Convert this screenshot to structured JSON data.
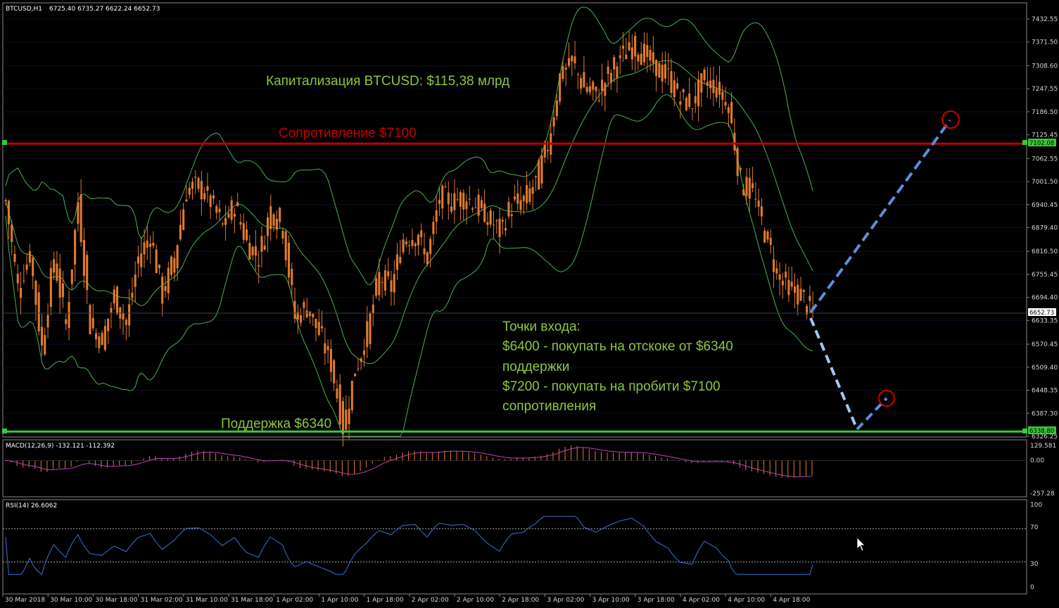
{
  "header": {
    "symbol": "BTCUSD,H1",
    "ohlc": "6725.40 6735.27 6622.24 6652.73"
  },
  "annotations": {
    "cap": "Капитализация BTCUSD: $115,38 млрд",
    "resistance": "Сопротивление $7100",
    "support": "Поддержка $6340",
    "entry_title": "Точки входа:",
    "entry_1a": "$6400 - покупать на отскоке от $6340",
    "entry_1b": "поддержки",
    "entry_2a": "$7200 - покупать на пробити $7100",
    "entry_2b": "сопротивления"
  },
  "colors": {
    "background": "#000000",
    "candle": "#e07b2c",
    "bands": "#4caf50",
    "resistance": "#c00000",
    "support": "#33cc33",
    "macd_hist": "#e07b2c",
    "macd_signal": "#c040c0",
    "rsi": "#3a6fd8",
    "forecast_up": "#5b8ede",
    "forecast_down": "#9ec9f0",
    "marker": "#cc0000"
  },
  "chart_data": {
    "type": "candlestick",
    "price_axis": {
      "ticks": [
        "7432.55",
        "7371.50",
        "7308.60",
        "7247.55",
        "7186.50",
        "7125.45",
        "7062.55",
        "7001.50",
        "6940.45",
        "6879.40",
        "6816.50",
        "6755.45",
        "6694.40",
        "6633.35",
        "6570.45",
        "6509.40",
        "6448.35",
        "6387.30",
        "6326.25"
      ],
      "range": [
        6326.25,
        7432.55
      ]
    },
    "time_axis": [
      "30 Mar 2018",
      "30 Mar 10:00",
      "30 Mar 18:00",
      "31 Mar 02:00",
      "31 Mar 10:00",
      "31 Mar 18:00",
      "1 Apr 02:00",
      "1 Apr 10:00",
      "1 Apr 18:00",
      "2 Apr 02:00",
      "2 Apr 10:00",
      "2 Apr 18:00",
      "3 Apr 02:00",
      "3 Apr 10:00",
      "3 Apr 18:00",
      "4 Apr 02:00",
      "4 Apr 10:00",
      "4 Apr 18:00"
    ],
    "resistance": {
      "label": "7102.08",
      "value": 7102.08
    },
    "support": {
      "label": "6338.80",
      "value": 6338.8
    },
    "current": {
      "label": "6652.73",
      "value": 6652.73
    },
    "close_path": [
      [
        0,
        6950
      ],
      [
        4,
        6720
      ],
      [
        8,
        6810
      ],
      [
        12,
        6560
      ],
      [
        16,
        6800
      ],
      [
        20,
        6620
      ],
      [
        24,
        6950
      ],
      [
        28,
        6620
      ],
      [
        32,
        6580
      ],
      [
        36,
        6700
      ],
      [
        40,
        6620
      ],
      [
        44,
        6800
      ],
      [
        48,
        6860
      ],
      [
        52,
        6700
      ],
      [
        56,
        6800
      ],
      [
        60,
        6980
      ],
      [
        64,
        6990
      ],
      [
        68,
        6950
      ],
      [
        72,
        6880
      ],
      [
        76,
        6940
      ],
      [
        80,
        6840
      ],
      [
        84,
        6800
      ],
      [
        88,
        6930
      ],
      [
        92,
        6880
      ],
      [
        96,
        6640
      ],
      [
        100,
        6670
      ],
      [
        104,
        6600
      ],
      [
        108,
        6520
      ],
      [
        112,
        6350
      ],
      [
        116,
        6500
      ],
      [
        120,
        6600
      ],
      [
        124,
        6750
      ],
      [
        128,
        6720
      ],
      [
        132,
        6850
      ],
      [
        136,
        6860
      ],
      [
        140,
        6800
      ],
      [
        144,
        6960
      ],
      [
        148,
        6950
      ],
      [
        152,
        6960
      ],
      [
        156,
        6940
      ],
      [
        160,
        6900
      ],
      [
        164,
        6870
      ],
      [
        168,
        6940
      ],
      [
        172,
        6950
      ],
      [
        176,
        7000
      ],
      [
        180,
        7100
      ],
      [
        184,
        7280
      ],
      [
        188,
        7320
      ],
      [
        192,
        7250
      ],
      [
        196,
        7230
      ],
      [
        200,
        7280
      ],
      [
        204,
        7330
      ],
      [
        208,
        7360
      ],
      [
        212,
        7340
      ],
      [
        216,
        7300
      ],
      [
        220,
        7280
      ],
      [
        224,
        7220
      ],
      [
        228,
        7210
      ],
      [
        232,
        7270
      ],
      [
        236,
        7250
      ],
      [
        240,
        7200
      ],
      [
        244,
        7000
      ],
      [
        248,
        6970
      ],
      [
        252,
        6870
      ],
      [
        256,
        6760
      ],
      [
        260,
        6720
      ],
      [
        264,
        6700
      ],
      [
        268,
        6652.73
      ]
    ],
    "bollinger": {
      "period": 20
    },
    "indicators": {
      "macd": {
        "label": "MACD(12,26,9) -132.121 -112.392",
        "ticks": [
          "129.581",
          "0.00",
          "-257.28"
        ],
        "range": [
          -257.28,
          129.581
        ]
      },
      "rsi": {
        "label": "RSI(14) 26.6062",
        "ticks": [
          "100",
          "70",
          "30",
          "0"
        ],
        "levels": [
          70,
          30
        ],
        "range": [
          0,
          100
        ]
      }
    },
    "forecast": {
      "down_target": 6338.8,
      "up_target_1": 6400,
      "up_target_2": 7200
    }
  }
}
